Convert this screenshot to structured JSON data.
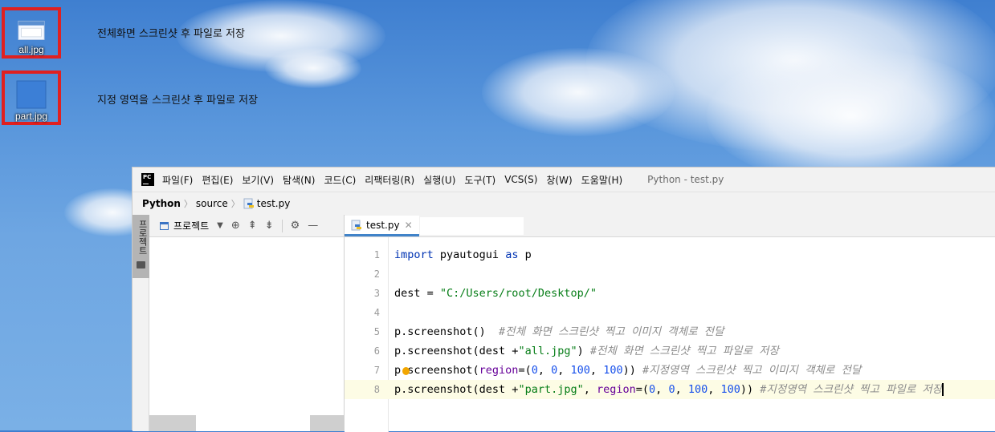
{
  "desktop": {
    "icons": [
      {
        "name": "all.jpg",
        "description": "전체화면 스크린샷 후 파일로 저장"
      },
      {
        "name": "part.jpg",
        "description": "지정 영역을 스크린샷 후 파일로 저장"
      }
    ]
  },
  "ide": {
    "logo_text": "PC",
    "menu": [
      "파일(F)",
      "편집(E)",
      "보기(V)",
      "탐색(N)",
      "코드(C)",
      "리팩터링(R)",
      "실행(U)",
      "도구(T)",
      "VCS(S)",
      "창(W)",
      "도움말(H)"
    ],
    "window_title": "Python - test.py",
    "breadcrumb": [
      "Python",
      "source",
      "test.py"
    ],
    "side_tab_label": "프로젝트",
    "project_panel": {
      "title": "프로젝트"
    },
    "editor_tab": {
      "label": "test.py"
    },
    "code_lines": [
      {
        "number": "1",
        "tokens": [
          {
            "t": "import",
            "c": "kw"
          },
          {
            "t": " pyautogui ",
            "c": ""
          },
          {
            "t": "as",
            "c": "kw"
          },
          {
            "t": " p",
            "c": ""
          }
        ]
      },
      {
        "number": "2",
        "tokens": []
      },
      {
        "number": "3",
        "tokens": [
          {
            "t": "dest = ",
            "c": ""
          },
          {
            "t": "\"C:/Users/root/Desktop/\"",
            "c": "str"
          }
        ]
      },
      {
        "number": "4",
        "tokens": []
      },
      {
        "number": "5",
        "tokens": [
          {
            "t": "p.screenshot()  ",
            "c": ""
          },
          {
            "t": "#전체 화면 스크린샷 찍고 이미지 객체로 전달",
            "c": "cmt"
          }
        ]
      },
      {
        "number": "6",
        "tokens": [
          {
            "t": "p.screenshot(dest +",
            "c": ""
          },
          {
            "t": "\"all.jpg\"",
            "c": "str"
          },
          {
            "t": ") ",
            "c": ""
          },
          {
            "t": "#전체 화면 스크린샷 찍고 파일로 저장",
            "c": "cmt"
          }
        ]
      },
      {
        "number": "7",
        "tokens": [
          {
            "t": "p.screenshot(",
            "c": ""
          },
          {
            "t": "region",
            "c": "param"
          },
          {
            "t": "=(",
            "c": ""
          },
          {
            "t": "0",
            "c": "num"
          },
          {
            "t": ", ",
            "c": ""
          },
          {
            "t": "0",
            "c": "num"
          },
          {
            "t": ", ",
            "c": ""
          },
          {
            "t": "100",
            "c": "num"
          },
          {
            "t": ", ",
            "c": ""
          },
          {
            "t": "100",
            "c": "num"
          },
          {
            "t": ")) ",
            "c": ""
          },
          {
            "t": "#지정영역 스크린샷 찍고 이미지 객체로 전달",
            "c": "cmt"
          }
        ]
      },
      {
        "number": "8",
        "tokens": [
          {
            "t": "p.screenshot(dest +",
            "c": ""
          },
          {
            "t": "\"part.jpg\"",
            "c": "str"
          },
          {
            "t": ", ",
            "c": ""
          },
          {
            "t": "region",
            "c": "param"
          },
          {
            "t": "=(",
            "c": ""
          },
          {
            "t": "0",
            "c": "num"
          },
          {
            "t": ", ",
            "c": ""
          },
          {
            "t": "0",
            "c": "num"
          },
          {
            "t": ", ",
            "c": ""
          },
          {
            "t": "100",
            "c": "num"
          },
          {
            "t": ", ",
            "c": ""
          },
          {
            "t": "100",
            "c": "num"
          },
          {
            "t": ")) ",
            "c": ""
          },
          {
            "t": "#지정영역 스크린샷 찍고 파일로 저장",
            "c": "cmt"
          }
        ]
      }
    ],
    "current_line": "8",
    "colors": {
      "keyword": "#0033b3",
      "string": "#067d17",
      "number": "#1750eb",
      "parameter": "#660099",
      "comment": "#8c8c8c",
      "current_line_bg": "#fdfce5",
      "tab_underline": "#4083c9"
    }
  }
}
